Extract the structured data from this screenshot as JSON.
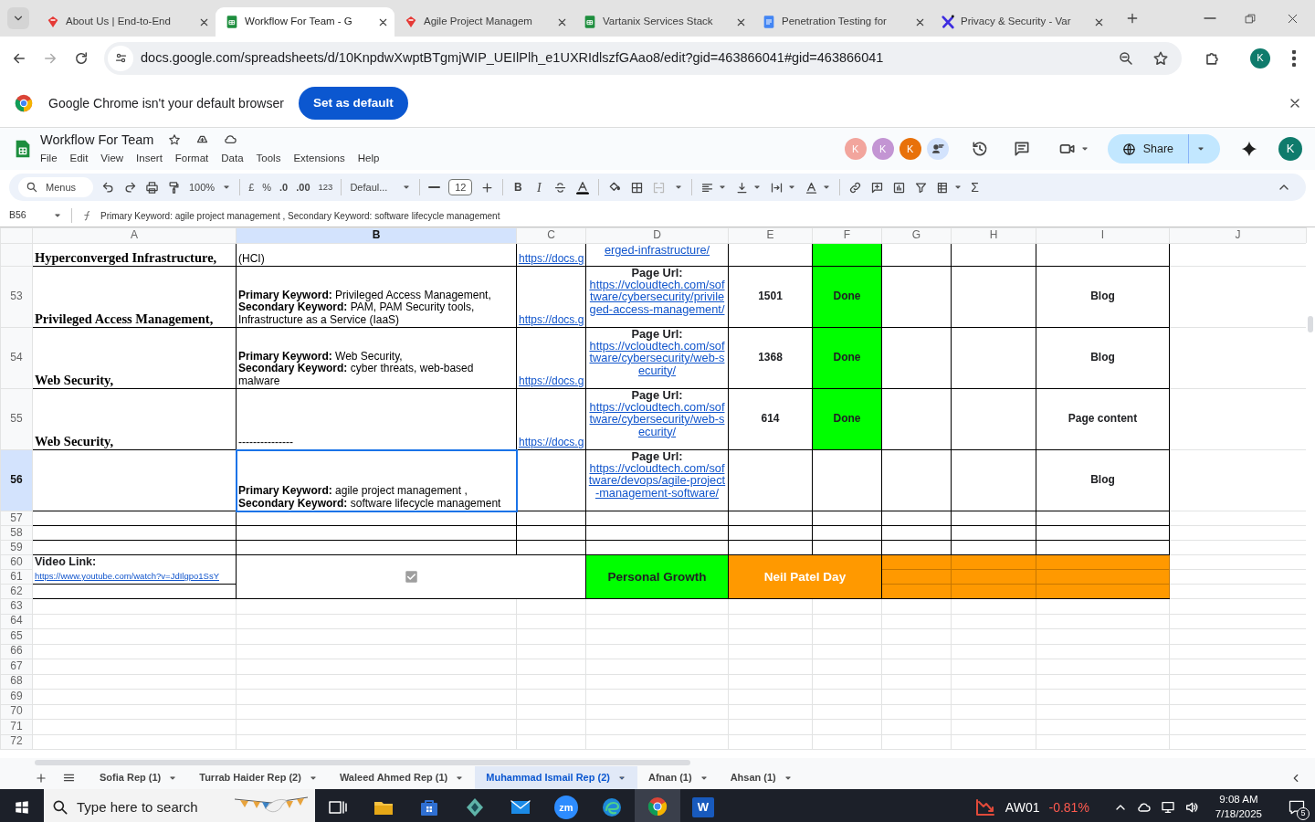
{
  "browser": {
    "tabs": [
      {
        "title": "About Us | End-to-End",
        "kind": "site",
        "selected": false
      },
      {
        "title": "Workflow For Team - G",
        "kind": "sheets",
        "selected": true
      },
      {
        "title": "Agile Project Managem",
        "kind": "site",
        "selected": false
      },
      {
        "title": "Vartanix Services Stack",
        "kind": "sheets",
        "selected": false
      },
      {
        "title": "Penetration Testing for",
        "kind": "docs",
        "selected": false
      },
      {
        "title": "Privacy & Security - Var",
        "kind": "x",
        "selected": false
      }
    ],
    "address": "docs.google.com/spreadsheets/d/10KnpdwXwptBTgmjWIP_UEIlPlh_e1UXRIdlszfGAao8/edit?gid=463866041#gid=463866041",
    "profile": "K",
    "infobar": {
      "message": "Google Chrome isn't your default browser",
      "button": "Set as default"
    }
  },
  "sheet": {
    "title": "Workflow For Team",
    "menu": [
      "File",
      "Edit",
      "View",
      "Insert",
      "Format",
      "Data",
      "Tools",
      "Extensions",
      "Help"
    ],
    "collaborators": [
      {
        "initial": "K",
        "color": "#f2a59d"
      },
      {
        "initial": "K",
        "color": "#c395d3"
      },
      {
        "initial": "K",
        "color": "#e8710a"
      }
    ],
    "share": "Share",
    "account": "K"
  },
  "toolbar": {
    "search": "Menus",
    "zoom": "100%",
    "currency": "£",
    "percent": "%",
    "decrease_decimals": ".0",
    "increase_decimals": ".00",
    "number_format": "123",
    "font": "Defaul...",
    "font_size": "12",
    "bold": "B",
    "italic": "I",
    "functions": "Σ"
  },
  "formula_bar": {
    "cell": "B56",
    "formula": "Primary Keyword:  agile project management , Secondary Keyword:  software lifecycle management"
  },
  "grid": {
    "columns": [
      {
        "label": "A",
        "selected": false
      },
      {
        "label": "B",
        "selected": true
      },
      {
        "label": "C",
        "selected": false
      },
      {
        "label": "D",
        "selected": false
      },
      {
        "label": "E",
        "selected": false
      },
      {
        "label": "F",
        "selected": false
      },
      {
        "label": "G",
        "selected": false
      },
      {
        "label": "H",
        "selected": false
      },
      {
        "label": "I",
        "selected": false
      },
      {
        "label": "J",
        "selected": false
      }
    ],
    "rows": [
      {
        "selected": false,
        "cells": [
          {
            "kind": "title",
            "text": "Hyperconverged Infrastructure,"
          },
          {
            "kind": "keywords",
            "text": "(HCI)"
          },
          {
            "kind": "link",
            "text": "https://docs.g"
          },
          {
            "kind": "page_url",
            "link": "erged-infrastructure/"
          },
          {
            "kind": "empty"
          },
          {
            "kind": "fill",
            "color": "#00ff00"
          },
          {
            "kind": "empty"
          },
          {
            "kind": "empty"
          },
          {
            "kind": "empty"
          }
        ]
      },
      {
        "number": "53",
        "selected": false,
        "cells": [
          {
            "kind": "title",
            "text": "Privileged Access Management,"
          },
          {
            "kind": "keywords",
            "text": "**Primary Keyword:** Privileged Access Management,\n**Secondary Keyword:** PAM, PAM Security tools,\nInfrastructure as a Service (IaaS)"
          },
          {
            "kind": "link",
            "text": "https://docs.g"
          },
          {
            "kind": "page_url",
            "label": "Page Url:",
            "link": "https://vcloudtech.com/software/cybersecurity/privileged-access-management/"
          },
          {
            "kind": "count",
            "text": "1501"
          },
          {
            "kind": "status",
            "text": "Done",
            "color": "#00ff00"
          },
          {
            "kind": "empty"
          },
          {
            "kind": "empty"
          },
          {
            "kind": "type",
            "text": "Blog"
          }
        ]
      },
      {
        "number": "54",
        "selected": false,
        "cells": [
          {
            "kind": "title",
            "text": "Web Security,"
          },
          {
            "kind": "keywords",
            "text": "**Primary Keyword:** Web Security,\n**Secondary Keyword:** cyber threats, web-based\nmalware"
          },
          {
            "kind": "link",
            "text": "https://docs.g"
          },
          {
            "kind": "page_url",
            "label": "Page Url:",
            "link": "https://vcloudtech.com/software/cybersecurity/web-security/"
          },
          {
            "kind": "count",
            "text": "1368"
          },
          {
            "kind": "status",
            "text": "Done",
            "color": "#00ff00"
          },
          {
            "kind": "empty"
          },
          {
            "kind": "empty"
          },
          {
            "kind": "type",
            "text": "Blog"
          }
        ]
      },
      {
        "number": "55",
        "selected": false,
        "cells": [
          {
            "kind": "title",
            "text": "Web Security,"
          },
          {
            "kind": "keywords",
            "text": "---------------"
          },
          {
            "kind": "link",
            "text": "https://docs.g"
          },
          {
            "kind": "page_url",
            "label": "Page Url:",
            "link": "https://vcloudtech.com/software/cybersecurity/web-security/"
          },
          {
            "kind": "count",
            "text": "614"
          },
          {
            "kind": "status",
            "text": "Done",
            "color": "#00ff00"
          },
          {
            "kind": "empty"
          },
          {
            "kind": "empty"
          },
          {
            "kind": "type",
            "text": "Page content"
          }
        ]
      },
      {
        "number": "56",
        "selected": true,
        "cells": [
          {
            "kind": "empty"
          },
          {
            "kind": "keywords",
            "text": "**Primary Keyword:**  agile project management ,\n**Secondary Keyword:**  software lifecycle management"
          },
          {
            "kind": "empty"
          },
          {
            "kind": "page_url",
            "label": "Page Url:",
            "link": "https://vcloudtech.com/software/devops/agile-project-management-software/"
          },
          {
            "kind": "empty"
          },
          {
            "kind": "empty"
          },
          {
            "kind": "empty"
          },
          {
            "kind": "empty"
          },
          {
            "kind": "type",
            "text": "Blog"
          }
        ]
      },
      {
        "number": "57",
        "selected": false
      },
      {
        "number": "58",
        "selected": false
      },
      {
        "number": "59",
        "selected": false
      }
    ],
    "summary": {
      "numbers": [
        "60",
        "61",
        "62"
      ],
      "video_label": "Video Link:",
      "video_link": "https://www.youtube.com/watch?v=JdIlgpo1SsY",
      "checked": true,
      "tags": [
        {
          "text": "Personal Growth",
          "color": "#00ff00"
        },
        {
          "text": "Neil Patel Day",
          "color": "#ff9900"
        }
      ],
      "trailing": [
        {
          "color": "#ff9900"
        },
        {
          "color": "#ff9900"
        },
        {
          "color": "#ff9900"
        }
      ]
    },
    "rows_after": [
      {
        "number": "63",
        "selected": false
      },
      {
        "number": "64",
        "selected": false
      },
      {
        "number": "65",
        "selected": false
      },
      {
        "number": "66",
        "selected": false
      },
      {
        "number": "67",
        "selected": false
      },
      {
        "number": "68",
        "selected": false
      },
      {
        "number": "69",
        "selected": false
      },
      {
        "number": "70",
        "selected": false
      },
      {
        "number": "71",
        "selected": false
      },
      {
        "number": "72",
        "selected": false
      }
    ]
  },
  "sheet_tabs": [
    {
      "name": "Sofia Rep (1)",
      "selected": false
    },
    {
      "name": "Turrab Haider Rep (2)",
      "selected": false
    },
    {
      "name": "Waleed Ahmed Rep (1)",
      "selected": false
    },
    {
      "name": "Muhammad Ismail Rep (2)",
      "selected": true
    },
    {
      "name": "Afnan (1)",
      "selected": false
    },
    {
      "name": "Ahsan (1)",
      "selected": false
    }
  ],
  "taskbar": {
    "search": "Type here to search",
    "zoom_label": "zm",
    "word_label": "W",
    "stock": "AW01",
    "change": "-0.81%",
    "time": "9:08 AM",
    "date": "7/18/2025",
    "notifications": "5"
  }
}
